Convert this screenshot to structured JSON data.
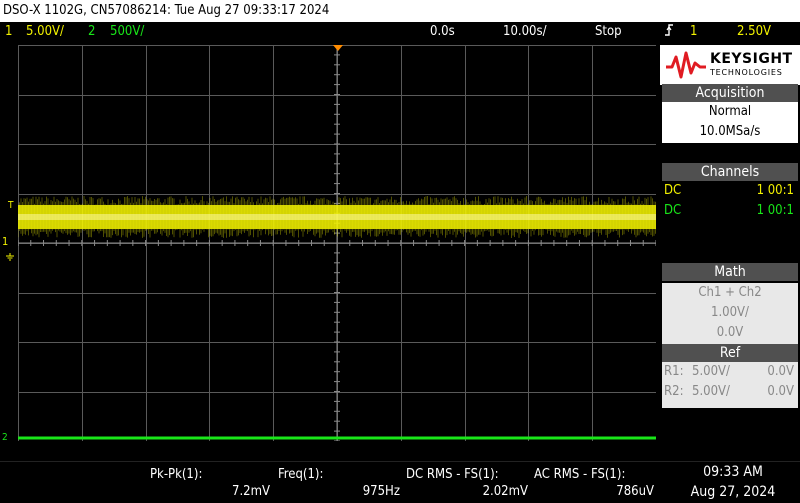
{
  "title_bar": "DSO-X 1102G, CN57086214: Tue Aug 27 09:33:17 2024",
  "top": {
    "ch1_num": "1",
    "ch1_scale": "5.00V/",
    "ch2_num": "2",
    "ch2_scale": "500V/",
    "time_offset": "0.0s",
    "time_scale": "10.00s/",
    "run_state": "Stop",
    "trigger_icon": "rising-edge-trigger-icon",
    "trigger_source": "1",
    "trigger_level": "2.50V"
  },
  "logo": {
    "brand": "KEYSIGHT",
    "sub": "TECHNOLOGIES"
  },
  "acquisition": {
    "header": "Acquisition",
    "mode": "Normal",
    "rate": "10.0MSa/s"
  },
  "channels": {
    "header": "Channels",
    "rows": [
      {
        "coupling": "DC",
        "probe": "1 00:1",
        "color": "#f2f200"
      },
      {
        "coupling": "DC",
        "probe": "1 00:1",
        "color": "#19e619"
      }
    ]
  },
  "math": {
    "header": "Math",
    "func": "Ch1 + Ch2",
    "scale": "1.00V/",
    "offset": "0.0V"
  },
  "ref": {
    "header": "Ref",
    "rows": [
      {
        "name": "R1:",
        "scale": "5.00V/",
        "offset": "0.0V"
      },
      {
        "name": "R2:",
        "scale": "5.00V/",
        "offset": "0.0V"
      }
    ]
  },
  "markers": {
    "trigger": "T",
    "ch1": "1",
    "ch2": "2"
  },
  "measurements": [
    {
      "label": "Pk-Pk(1):",
      "value": "7.2mV"
    },
    {
      "label": "Freq(1):",
      "value": "975Hz"
    },
    {
      "label": "DC RMS - FS(1):",
      "value": "2.02mV"
    },
    {
      "label": "AC RMS - FS(1):",
      "value": "786uV"
    }
  ],
  "clock": {
    "time": "09:33 AM",
    "date": "Aug 27, 2024"
  },
  "colors": {
    "ch1": "#f2f200",
    "ch2": "#19e619",
    "grid": "#5a5a5a",
    "trigger_marker": "#ff8c00",
    "logo_red": "#e01b22"
  }
}
